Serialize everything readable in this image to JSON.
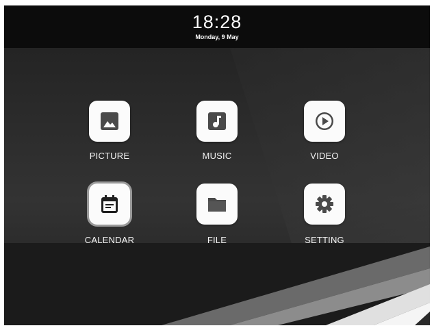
{
  "status_bar": {
    "time": "18:28",
    "date": "Monday, 9 May"
  },
  "apps": [
    {
      "label": "PICTURE",
      "icon": "image-icon"
    },
    {
      "label": "MUSIC",
      "icon": "music-note-icon"
    },
    {
      "label": "VIDEO",
      "icon": "play-icon"
    },
    {
      "label": "CALENDAR",
      "icon": "calendar-icon"
    },
    {
      "label": "FILE",
      "icon": "folder-icon"
    },
    {
      "label": "SETTING",
      "icon": "gear-icon"
    }
  ],
  "colors": {
    "status_bar": "#0c0c0c",
    "icon_tile": "#fbfbfb",
    "icon_glyph": "#4a4a4a",
    "label_text": "#f2f2f2"
  }
}
